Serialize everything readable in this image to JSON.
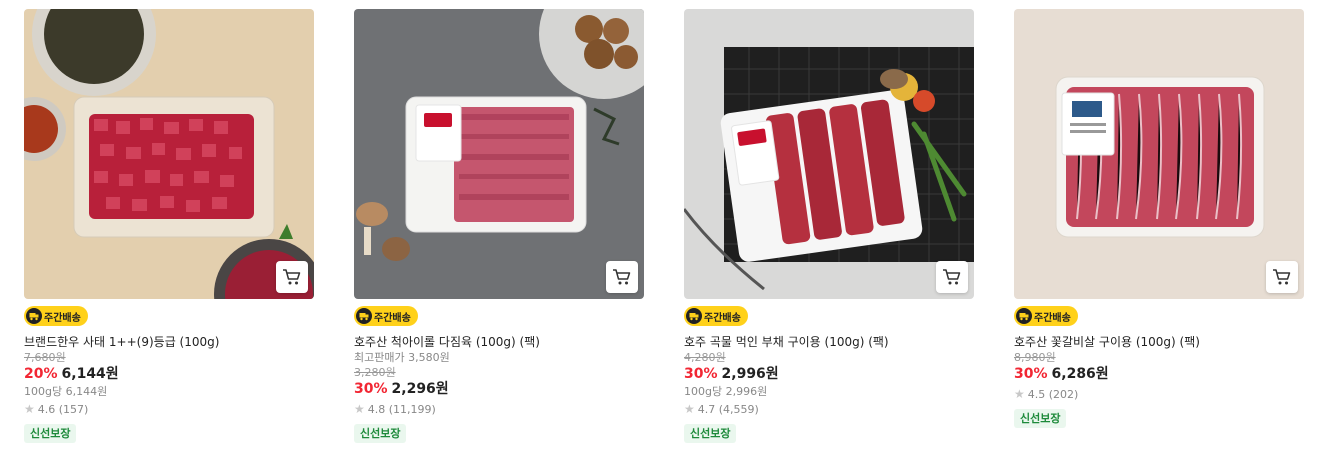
{
  "products": [
    {
      "badge": "주간배송",
      "title": "브랜드한우 사태 1++(9)등급 (100g)",
      "original_price": "7,680원",
      "discount_rate": "20%",
      "price": "6,144원",
      "unit_price": "100g당 6,144원",
      "rating": "4.6",
      "review_count": "(157)",
      "tag": "신선보장"
    },
    {
      "badge": "주간배송",
      "title": "호주산 척아이롤 다짐육 (100g) (팩)",
      "lowest_price_note": "최고판매가 3,580원",
      "original_price": "3,280원",
      "discount_rate": "30%",
      "price": "2,296원",
      "rating": "4.8",
      "review_count": "(11,199)",
      "tag": "신선보장"
    },
    {
      "badge": "주간배송",
      "title": "호주 곡물 먹인 부채 구이용 (100g) (팩)",
      "original_price": "4,280원",
      "discount_rate": "30%",
      "price": "2,996원",
      "unit_price": "100g당 2,996원",
      "rating": "4.7",
      "review_count": "(4,559)",
      "tag": "신선보장"
    },
    {
      "badge": "주간배송",
      "title": "호주산 꽃갈비살 구이용 (100g) (팩)",
      "original_price": "8,980원",
      "discount_rate": "30%",
      "price": "6,286원",
      "rating": "4.5",
      "review_count": "(202)",
      "tag": "신선보장"
    }
  ],
  "colors": {
    "discount": "#f22633",
    "badge_yellow": "#ffd11a",
    "fresh_text": "#1d8a3a",
    "fresh_bg": "#eaf7ee"
  },
  "icons": [
    "cart-icon",
    "truck-icon",
    "star-icon"
  ]
}
